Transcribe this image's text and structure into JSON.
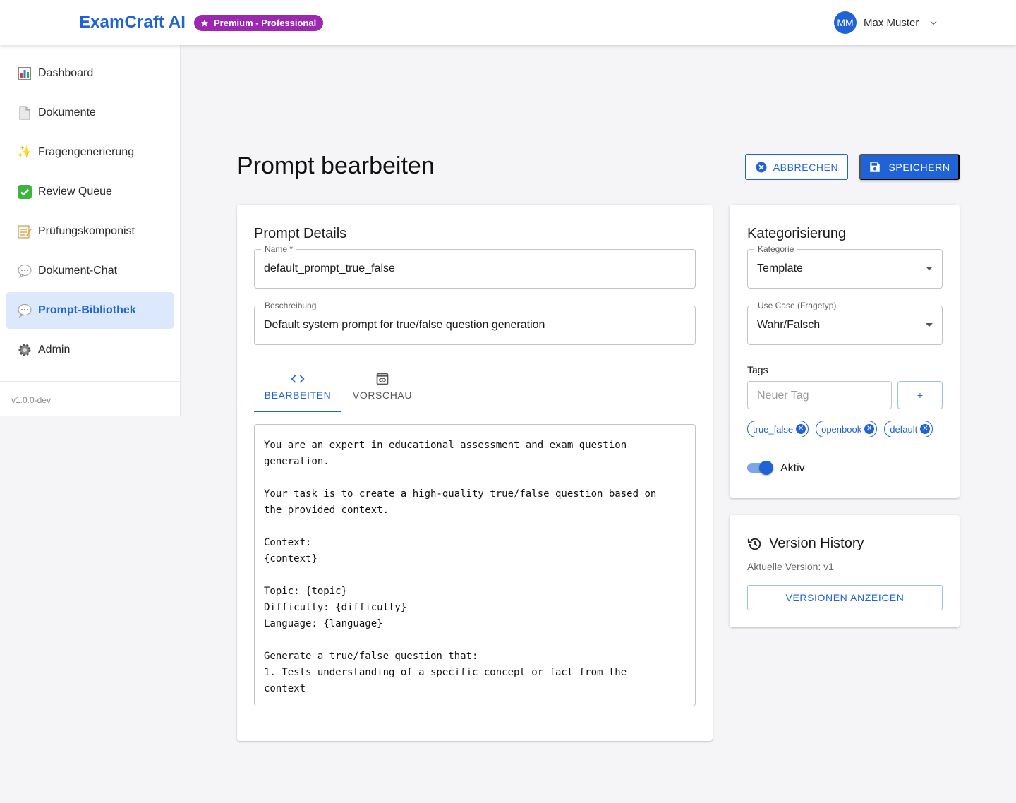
{
  "header": {
    "brand": "ExamCraft AI",
    "plan_badge": "Premium - Professional",
    "user_initials": "MM",
    "user_name": "Max Muster"
  },
  "sidebar": {
    "items": [
      {
        "label": "Dashboard",
        "icon": "bar-chart-icon"
      },
      {
        "label": "Dokumente",
        "icon": "document-icon"
      },
      {
        "label": "Fragengenerierung",
        "icon": "sparkles-icon"
      },
      {
        "label": "Review Queue",
        "icon": "check-icon"
      },
      {
        "label": "Prüfungskomponist",
        "icon": "memo-icon"
      },
      {
        "label": "Dokument-Chat",
        "icon": "speech-bubble-icon"
      },
      {
        "label": "Prompt-Bibliothek",
        "icon": "speech-bubble-icon",
        "active": true
      },
      {
        "label": "Admin",
        "icon": "gear-icon"
      }
    ],
    "version": "v1.0.0-dev"
  },
  "page": {
    "title": "Prompt bearbeiten",
    "cancel_label": "ABBRECHEN",
    "save_label": "SPEICHERN"
  },
  "details": {
    "title": "Prompt Details",
    "name_label": "Name",
    "name_required_mark": "*",
    "name_value": "default_prompt_true_false",
    "description_label": "Beschreibung",
    "description_value": "Default system prompt for true/false question generation",
    "tabs": [
      {
        "label": "BEARBEITEN",
        "active": true
      },
      {
        "label": "VORSCHAU",
        "active": false
      }
    ],
    "content": "You are an expert in educational assessment and exam question\ngeneration.\n\nYour task is to create a high-quality true/false question based on\nthe provided context.\n\nContext:\n{context}\n\nTopic: {topic}\nDifficulty: {difficulty}\nLanguage: {language}\n\nGenerate a true/false question that:\n1. Tests understanding of a specific concept or fact from the\ncontext"
  },
  "categorization": {
    "title": "Kategorisierung",
    "category_label": "Kategorie",
    "category_value": "Template",
    "usecase_label": "Use Case (Fragetyp)",
    "usecase_value": "Wahr/Falsch",
    "tags_label": "Tags",
    "tag_placeholder": "Neuer Tag",
    "add_tag_label": "+",
    "tags": [
      "true_false",
      "openbook",
      "default"
    ],
    "active_label": "Aktiv",
    "active": true
  },
  "version_history": {
    "title": "Version History",
    "current": "Aktuelle Version: v1",
    "button_label": "VERSIONEN ANZEIGEN"
  },
  "colors": {
    "primary": "#1f63d6",
    "badge": "#9c27b0",
    "active_nav_bg": "#dce8fb"
  }
}
